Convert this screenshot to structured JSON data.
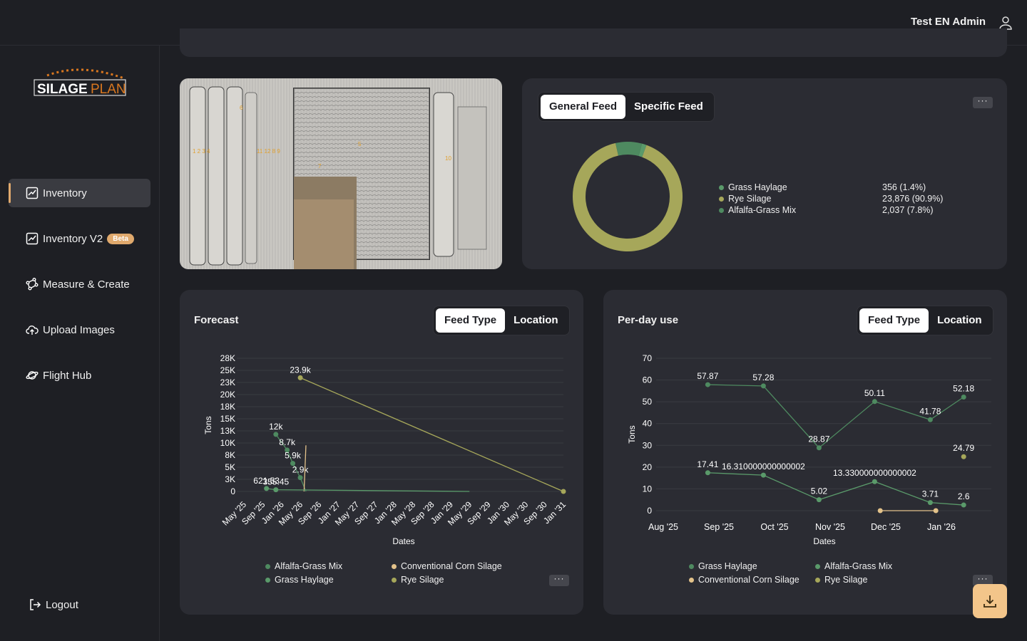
{
  "header": {
    "user_name": "Test EN Admin",
    "user_icon": "user-icon"
  },
  "logo": {
    "text_a": "SILAGE",
    "text_b": "PLAN"
  },
  "sidebar": {
    "items": [
      {
        "label": "Inventory",
        "icon": "chart-icon",
        "active": true
      },
      {
        "label": "Inventory V2",
        "icon": "chart-icon",
        "badge": "Beta"
      },
      {
        "label": "Measure & Create",
        "icon": "measure-icon"
      },
      {
        "label": "Upload Images",
        "icon": "cloud-upload-icon"
      },
      {
        "label": "Flight Hub",
        "icon": "planet-icon"
      }
    ],
    "logout": "Logout"
  },
  "feed_card": {
    "tabs": [
      "General Feed",
      "Specific Feed"
    ],
    "more": "···",
    "chart_data": {
      "type": "pie",
      "labels": [
        "Grass Haylage",
        "Rye Silage",
        "Alfalfa-Grass Mix"
      ],
      "values": [
        356,
        23876,
        2037
      ],
      "value_labels": [
        "356 (1.4%)",
        "23,876 (90.9%)",
        "2,037 (7.8%)"
      ],
      "colors": [
        "#5a9a6a",
        "#a6a75a",
        "#4e8a60"
      ]
    }
  },
  "forecast": {
    "title": "Forecast",
    "tabs": [
      "Feed Type",
      "Location"
    ],
    "more": "···",
    "chart_data": {
      "type": "line",
      "ylabel": "Tons",
      "xlabel": "Dates",
      "yticks": [
        "28K",
        "25K",
        "23K",
        "20K",
        "18K",
        "15K",
        "13K",
        "10K",
        "8K",
        "5K",
        "3K",
        "0"
      ],
      "xticks": [
        "May '25",
        "Sep '25",
        "Jan '26",
        "May '26",
        "Sep '26",
        "Jan '27",
        "May '27",
        "Sep '27",
        "Jan '28",
        "May '28",
        "Sep '28",
        "Jan '29",
        "May '29",
        "Sep '29",
        "Jan '30",
        "May '30",
        "Sep '30",
        "Jan '31"
      ],
      "series": [
        {
          "name": "Alfalfa-Grass Mix",
          "color": "#4e8a60",
          "points": [
            [
              12000,
              1.7
            ],
            [
              8700,
              2.3
            ],
            [
              5900,
              2.6
            ],
            [
              2900,
              3.0
            ],
            [
              0,
              3.3
            ]
          ],
          "labels": [
            "12k",
            "8.7k",
            "5.9k",
            "2.9k",
            ""
          ]
        },
        {
          "name": "Conventional Corn Silage",
          "color": "#e3c28a",
          "points": [
            [
              0,
              3.2
            ],
            [
              9700,
              3.3
            ]
          ]
        },
        {
          "name": "Grass Haylage",
          "color": "#5a9a6a",
          "points": [
            [
              621.53,
              1.2
            ],
            [
              355.45,
              1.7
            ],
            [
              0,
              12.0
            ]
          ],
          "labels": [
            "621.53",
            "355.45",
            ""
          ]
        },
        {
          "name": "Rye Silage",
          "color": "#a6a75a",
          "points": [
            [
              23900,
              3.0
            ],
            [
              0,
              17.0
            ]
          ],
          "labels": [
            "23.9k",
            ""
          ]
        }
      ]
    },
    "legend": [
      "Alfalfa-Grass Mix",
      "Conventional Corn Silage",
      "Grass Haylage",
      "Rye Silage"
    ]
  },
  "perday": {
    "title": "Per-day use",
    "tabs": [
      "Feed Type",
      "Location"
    ],
    "more": "···",
    "chart_data": {
      "type": "line",
      "ylabel": "Tons",
      "xlabel": "Dates",
      "yticks": [
        "70",
        "60",
        "50",
        "40",
        "30",
        "20",
        "10",
        "0"
      ],
      "ylim": [
        0,
        70
      ],
      "xticks": [
        "Aug '25",
        "Sep '25",
        "Oct '25",
        "Nov '25",
        "Dec '25",
        "Jan '26"
      ],
      "series": [
        {
          "name": "Grass Haylage",
          "color": "#4e8a60",
          "x": [
            0.8,
            1.8,
            2.8,
            3.8,
            4.8,
            5.4
          ],
          "values": [
            57.87,
            57.28,
            28.87,
            50.11,
            41.78,
            52.18
          ],
          "labels": [
            "57.87",
            "57.28",
            "28.87",
            "50.11",
            "41.78",
            "52.18"
          ]
        },
        {
          "name": "Alfalfa-Grass Mix",
          "color": "#5a9a6a",
          "x": [
            0.8,
            1.8,
            2.8,
            3.8,
            4.8,
            5.4
          ],
          "values": [
            17.41,
            16.310000000000002,
            5.02,
            13.330000000000002,
            3.71,
            2.6
          ],
          "labels": [
            "17.41",
            "16.310000000000002",
            "5.02",
            "13.330000000000002",
            "3.71",
            "2.6"
          ]
        },
        {
          "name": "Conventional Corn Silage",
          "color": "#e3c28a",
          "x": [
            3.9,
            4.9
          ],
          "values": [
            0,
            0
          ],
          "labels": [
            "",
            ""
          ]
        },
        {
          "name": "Rye Silage",
          "color": "#a6a75a",
          "x": [
            5.4
          ],
          "values": [
            24.79
          ],
          "labels": [
            "24.79"
          ]
        }
      ]
    },
    "legend": [
      "Grass Haylage",
      "Alfalfa-Grass Mix",
      "Conventional Corn Silage",
      "Rye Silage"
    ]
  },
  "download_icon": "download-icon"
}
